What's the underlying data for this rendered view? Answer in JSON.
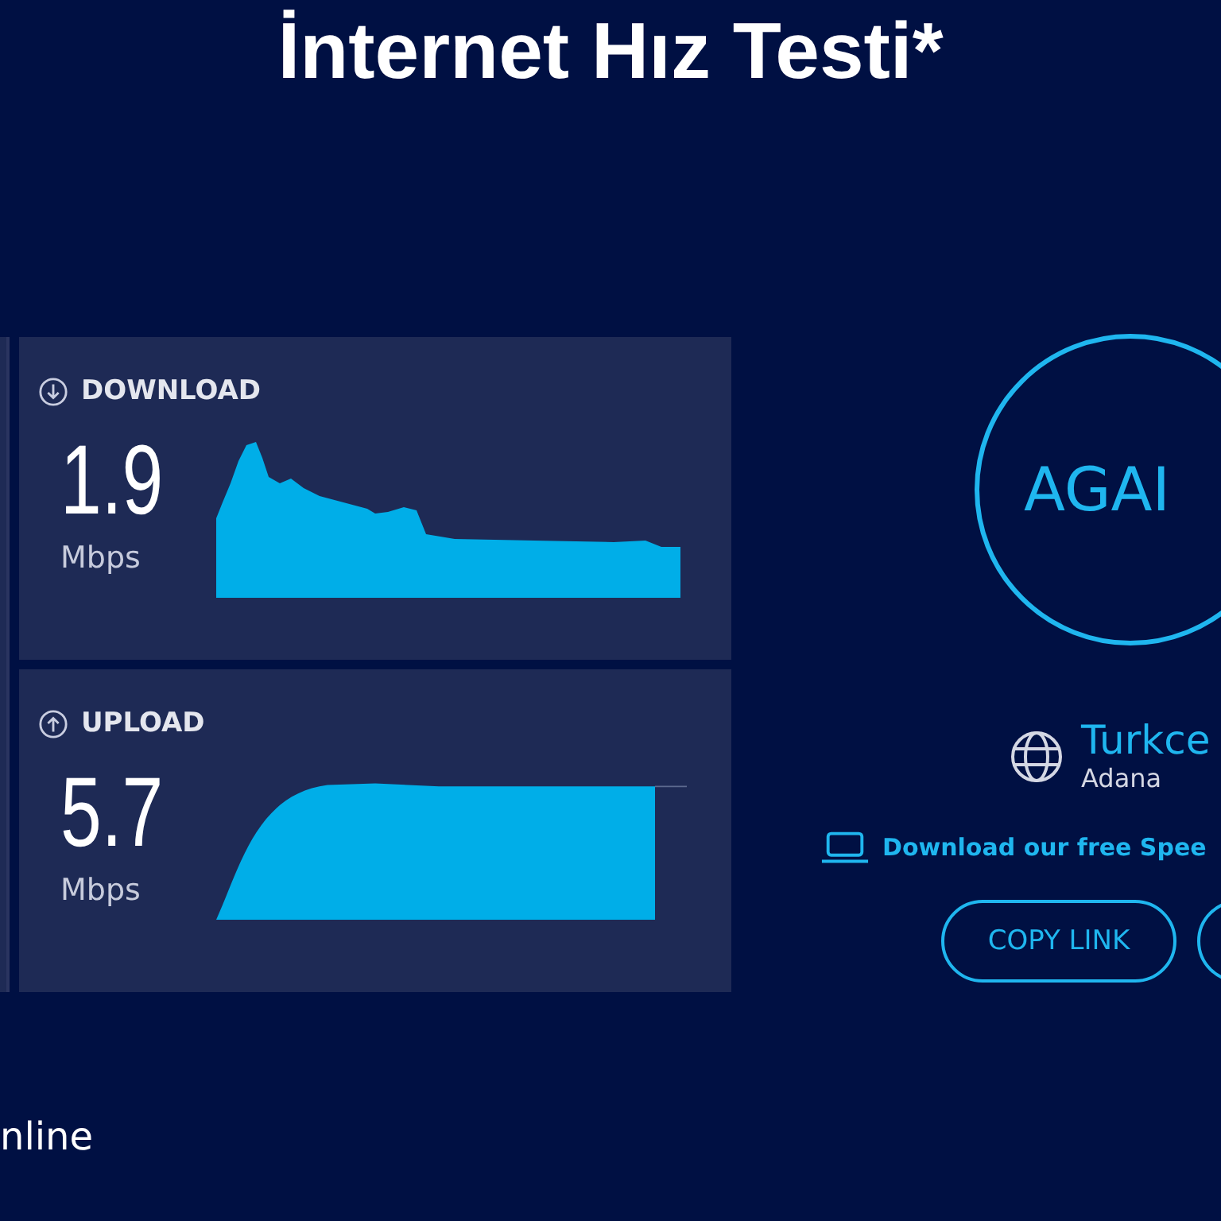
{
  "title": "İnternet Hız Testi*",
  "results": [
    {
      "kind": "download",
      "label": "DOWNLOAD",
      "value": "1.9",
      "unit": "Mbps"
    },
    {
      "kind": "upload",
      "label": "UPLOAD",
      "value": "5.7",
      "unit": "Mbps"
    }
  ],
  "again_button": {
    "label": "AGAI"
  },
  "provider": {
    "name": "Turkce",
    "location": "Adana"
  },
  "app_link": {
    "text": "Download our free Spee"
  },
  "copy_link_button": {
    "label": "COPY LINK"
  },
  "footer_text": "nline"
}
